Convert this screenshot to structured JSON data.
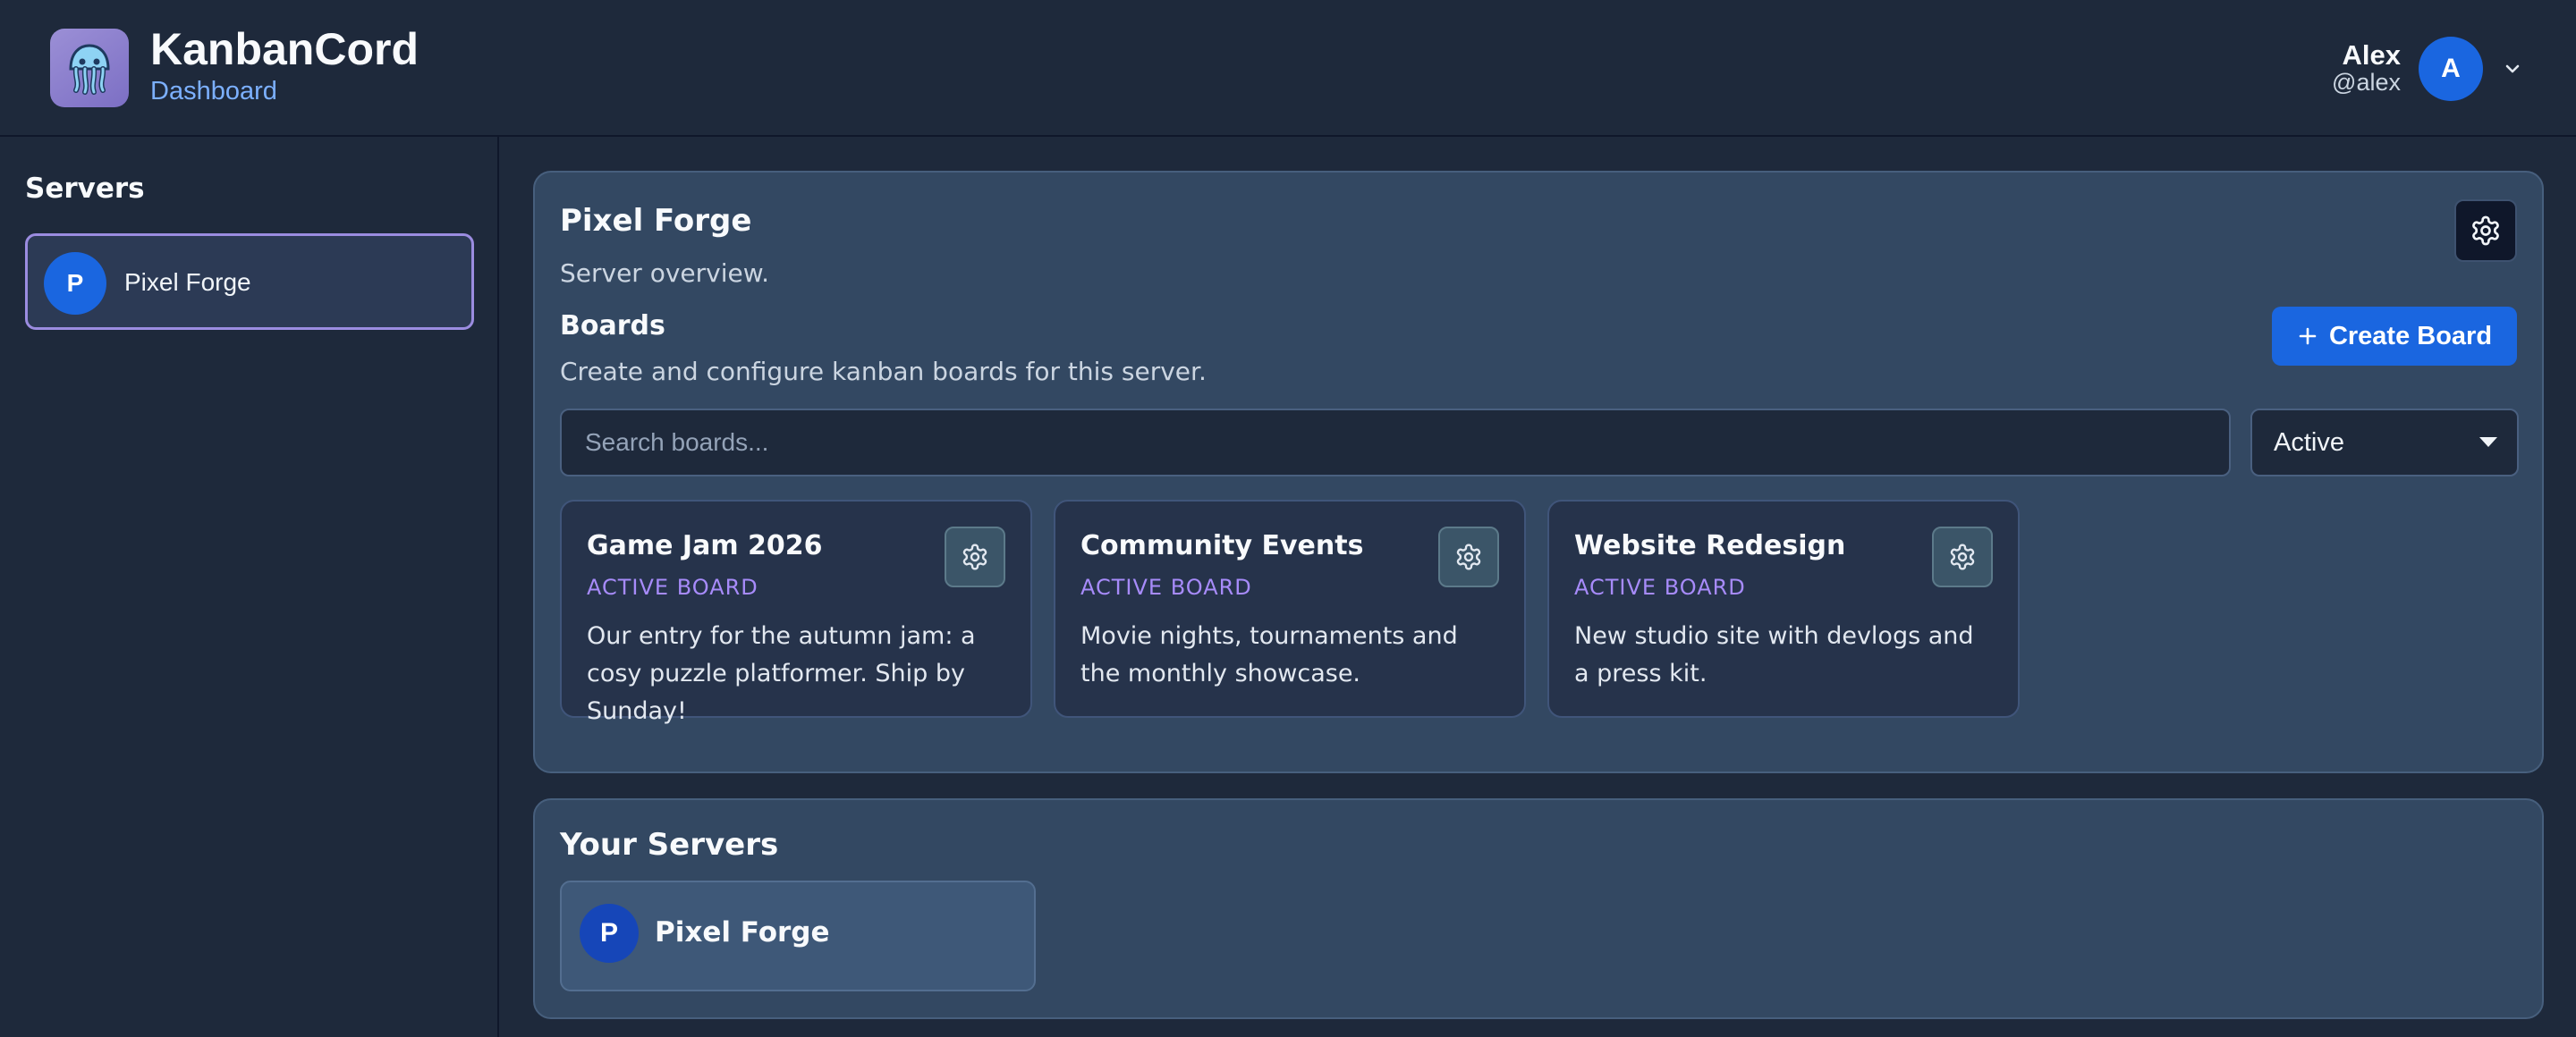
{
  "header": {
    "app_title": "KanbanCord",
    "app_subtitle": "Dashboard",
    "logo_icon": "jellyfish-icon",
    "user": {
      "name": "Alex",
      "handle": "@alex",
      "avatar_letter": "A"
    }
  },
  "sidebar": {
    "title": "Servers",
    "servers": [
      {
        "letter": "P",
        "name": "Pixel Forge",
        "selected": true
      }
    ]
  },
  "server_panel": {
    "title": "Pixel Forge",
    "description": "Server overview.",
    "boards_section": {
      "title": "Boards",
      "description": "Create and configure kanban boards for this server.",
      "create_label": "Create Board",
      "search_placeholder": "Search boards...",
      "filter_value": "Active"
    },
    "boards": [
      {
        "title": "Game Jam 2026",
        "status": "ACTIVE BOARD",
        "description": "Our entry for the autumn jam: a cosy puzzle platformer. Ship by Sunday!"
      },
      {
        "title": "Community Events",
        "status": "ACTIVE BOARD",
        "description": "Movie nights, tournaments and the monthly showcase."
      },
      {
        "title": "Website Redesign",
        "status": "ACTIVE BOARD",
        "description": "New studio site with devlogs and a press kit."
      }
    ]
  },
  "your_servers": {
    "title": "Your Servers",
    "servers": [
      {
        "letter": "P",
        "name": "Pixel Forge"
      }
    ]
  },
  "colors": {
    "accent": "#1a66e0",
    "status_purple": "#a78bfa",
    "selection_border": "#9b8ce0"
  }
}
